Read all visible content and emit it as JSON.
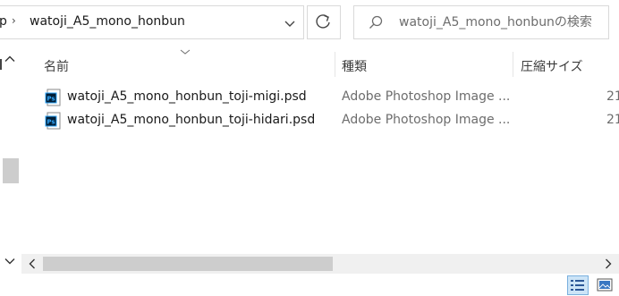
{
  "address_bar": {
    "prev_crumb": "p",
    "separator": "›",
    "current_folder": "watoji_A5_mono_honbun"
  },
  "search": {
    "placeholder": "watoji_A5_mono_honbunの検索"
  },
  "columns": {
    "name": "名前",
    "type": "種類",
    "compressed_size": "圧縮サイズ"
  },
  "files": [
    {
      "name": "watoji_A5_mono_honbun_toji-migi.psd",
      "type": "Adobe Photoshop Image ...",
      "size": "21",
      "icon": "photoshop-file-icon"
    },
    {
      "name": "watoji_A5_mono_honbun_toji-hidari.psd",
      "type": "Adobe Photoshop Image ...",
      "size": "21",
      "icon": "photoshop-file-icon"
    }
  ],
  "colors": {
    "selected_view_bg": "#cce4f7",
    "selected_view_border": "#7ab0de",
    "border": "#d9d9d9",
    "ps_icon_bg": "#001e36",
    "ps_icon_text": "#31a8ff"
  },
  "icons": {
    "search": "search-icon",
    "refresh": "refresh-icon",
    "dropdown": "chevron-down-icon",
    "details_view": "details-view-icon",
    "large_icons_view": "large-icons-view-icon"
  }
}
